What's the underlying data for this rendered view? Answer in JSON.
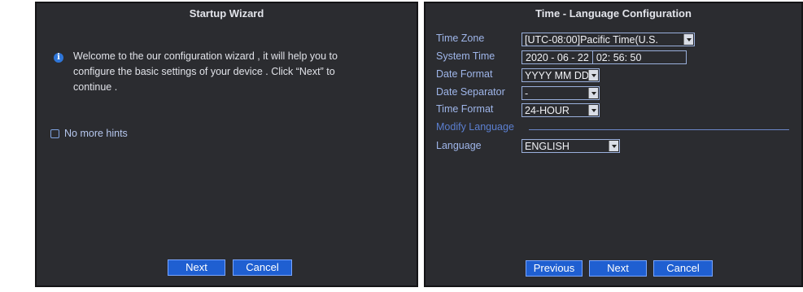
{
  "wizard": {
    "title": "Startup Wizard",
    "welcome_text": "Welcome to the our configuration wizard , it will help you to configure the basic settings of your device . Click “Next” to continue .",
    "no_more_hints_label": "No more hints",
    "next_label": "Next",
    "cancel_label": "Cancel"
  },
  "time_language": {
    "title": "Time - Language Configuration",
    "time_zone": {
      "label": "Time Zone",
      "value": "[UTC-08:00]Pacific Time(U.S."
    },
    "system_time": {
      "label": "System Time",
      "date": "2020 - 06 - 22",
      "time": "02: 56: 50"
    },
    "date_format": {
      "label": "Date Format",
      "value": "YYYY MM DD"
    },
    "date_separator": {
      "label": "Date Separator",
      "value": "-"
    },
    "time_format": {
      "label": "Time Format",
      "value": "24-HOUR"
    },
    "modify_language_heading": "Modify Language",
    "language": {
      "label": "Language",
      "value": "ENGLISH"
    },
    "previous_label": "Previous",
    "next_label": "Next",
    "cancel_label": "Cancel"
  }
}
